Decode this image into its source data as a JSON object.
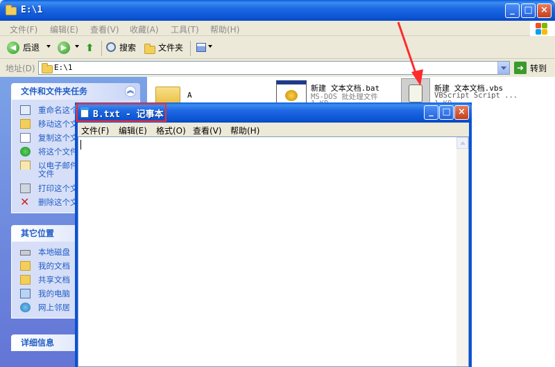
{
  "explorer": {
    "title": "E:\\1",
    "menu": [
      "文件(F)",
      "编辑(E)",
      "查看(V)",
      "收藏(A)",
      "工具(T)",
      "帮助(H)"
    ],
    "toolbar": {
      "back": "后退",
      "search": "搜索",
      "folders": "文件夹"
    },
    "address": {
      "label": "地址(D)",
      "value": "E:\\1",
      "go": "转到"
    },
    "tasks": {
      "header": "文件和文件夹任务",
      "items": [
        "重命名这个",
        "移动这个文",
        "复制这个文",
        "将这个文件",
        "以电子邮件",
        "文件",
        "打印这个文",
        "删除这个文"
      ]
    },
    "places": {
      "header": "其它位置",
      "items": [
        "本地磁盘",
        "我的文档",
        "共享文档",
        "我的电脑",
        "网上邻居"
      ]
    },
    "details": {
      "header": "详细信息"
    },
    "files": [
      {
        "name": "A"
      },
      {
        "name": "新建 文本文档.bat",
        "type": "MS-DOS 批处理文件",
        "size": "1 KB"
      },
      {
        "name": "新建 文本文档.vbs",
        "type": "VBScript Script ...",
        "size": "1 KB"
      }
    ]
  },
  "notepad": {
    "title": "B.txt - 记事本",
    "menu": [
      "文件(F)",
      "编辑(E)",
      "格式(O)",
      "查看(V)",
      "帮助(H)"
    ],
    "content": ""
  },
  "colors": {
    "xp_blue": "#0a52d6",
    "task_link": "#215dc6",
    "highlight": "#ff2a2a"
  }
}
